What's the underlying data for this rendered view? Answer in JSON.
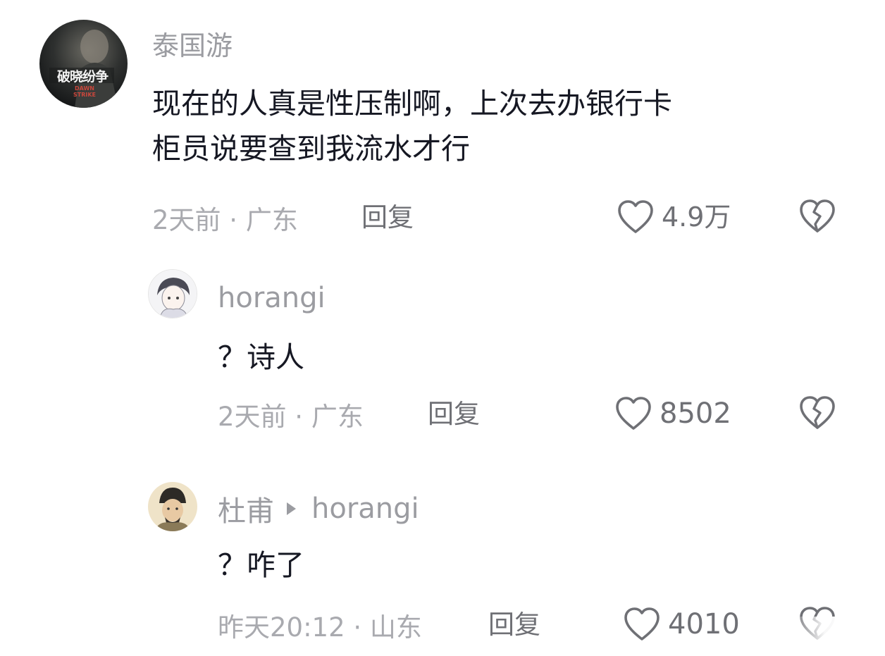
{
  "comments": [
    {
      "author": "泰国游",
      "avatar_text": "破晓纷争",
      "avatar_subtext": "DAWN STRIKE",
      "lines": [
        "现在的人真是性压制啊，上次去办银行卡",
        "柜员说要查到我流水才行"
      ],
      "time_location": "2天前 · 广东",
      "reply_label": "回复",
      "likes": "4.9万"
    },
    {
      "author": "horangi",
      "lines": [
        "？诗人"
      ],
      "time_location": "2天前 · 广东",
      "reply_label": "回复",
      "likes": "8502"
    },
    {
      "author": "杜甫",
      "reply_to": "horangi",
      "lines": [
        "？咋了"
      ],
      "time_location": "昨天20:12 · 山东",
      "reply_label": "回复",
      "likes": "4010"
    }
  ],
  "icons": {
    "like": "heart-outline-icon",
    "dislike": "broken-heart-icon"
  },
  "colors": {
    "text_primary": "#161823",
    "text_secondary": "#9b9ca1",
    "icon_gray": "#6f7075"
  }
}
